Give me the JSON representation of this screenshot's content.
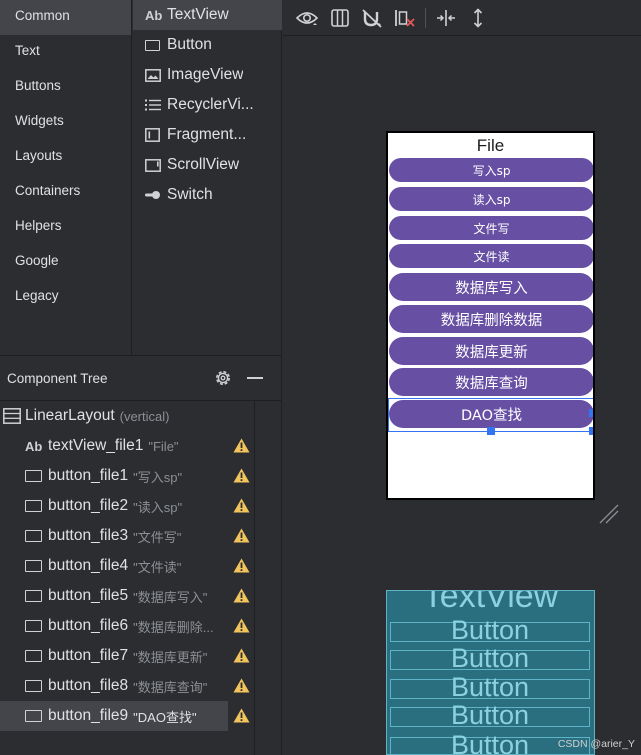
{
  "palette": {
    "categories": [
      {
        "label": "Common"
      },
      {
        "label": "Text"
      },
      {
        "label": "Buttons"
      },
      {
        "label": "Widgets"
      },
      {
        "label": "Layouts"
      },
      {
        "label": "Containers"
      },
      {
        "label": "Helpers"
      },
      {
        "label": "Google"
      },
      {
        "label": "Legacy"
      }
    ],
    "selected_category": "Common",
    "components": [
      {
        "label": "TextView",
        "icon": "textview-icon",
        "icon_text": "Ab"
      },
      {
        "label": "Button",
        "icon": "button-icon"
      },
      {
        "label": "ImageView",
        "icon": "imageview-icon"
      },
      {
        "label": "RecyclerVi...",
        "icon": "recyclerview-icon"
      },
      {
        "label": "Fragment...",
        "icon": "fragment-icon"
      },
      {
        "label": "ScrollView",
        "icon": "scrollview-icon"
      },
      {
        "label": "Switch",
        "icon": "switch-icon"
      }
    ]
  },
  "component_tree": {
    "header": "Component Tree",
    "root": {
      "name": "LinearLayout",
      "hint": "(vertical)"
    },
    "items": [
      {
        "icon_text": "Ab",
        "name": "textView_file1",
        "hint": "\"File\""
      },
      {
        "name": "button_file1",
        "hint": "\"写入sp\""
      },
      {
        "name": "button_file2",
        "hint": "\"读入sp\""
      },
      {
        "name": "button_file3",
        "hint": "\"文件写\""
      },
      {
        "name": "button_file4",
        "hint": "\"文件读\""
      },
      {
        "name": "button_file5",
        "hint": "\"数据库写入\""
      },
      {
        "name": "button_file6",
        "hint": "\"数据库删除..."
      },
      {
        "name": "button_file7",
        "hint": "\"数据库更新\""
      },
      {
        "name": "button_file8",
        "hint": "\"数据库查询\""
      },
      {
        "name": "button_file9",
        "hint": "\"DAO查找\""
      }
    ],
    "selected_item": "button_file9"
  },
  "design": {
    "title": "File",
    "buttons": [
      {
        "label": "写入sp"
      },
      {
        "label": "读入sp"
      },
      {
        "label": "文件写"
      },
      {
        "label": "文件读"
      },
      {
        "label": "数据库写入"
      },
      {
        "label": "数据库删除数据"
      },
      {
        "label": "数据库更新"
      },
      {
        "label": "数据库查询"
      },
      {
        "label": "DAO查找"
      }
    ]
  },
  "blueprint": {
    "title": "TextView",
    "buttons": [
      "Button",
      "Button",
      "Button",
      "Button",
      "Button"
    ]
  },
  "watermark": "CSDN @arier_Y",
  "colors": {
    "button_fill": "#6750a4",
    "selection": "#3574f0",
    "warning": "#f2c55c",
    "blueprint_bg": "#2a6f80"
  }
}
